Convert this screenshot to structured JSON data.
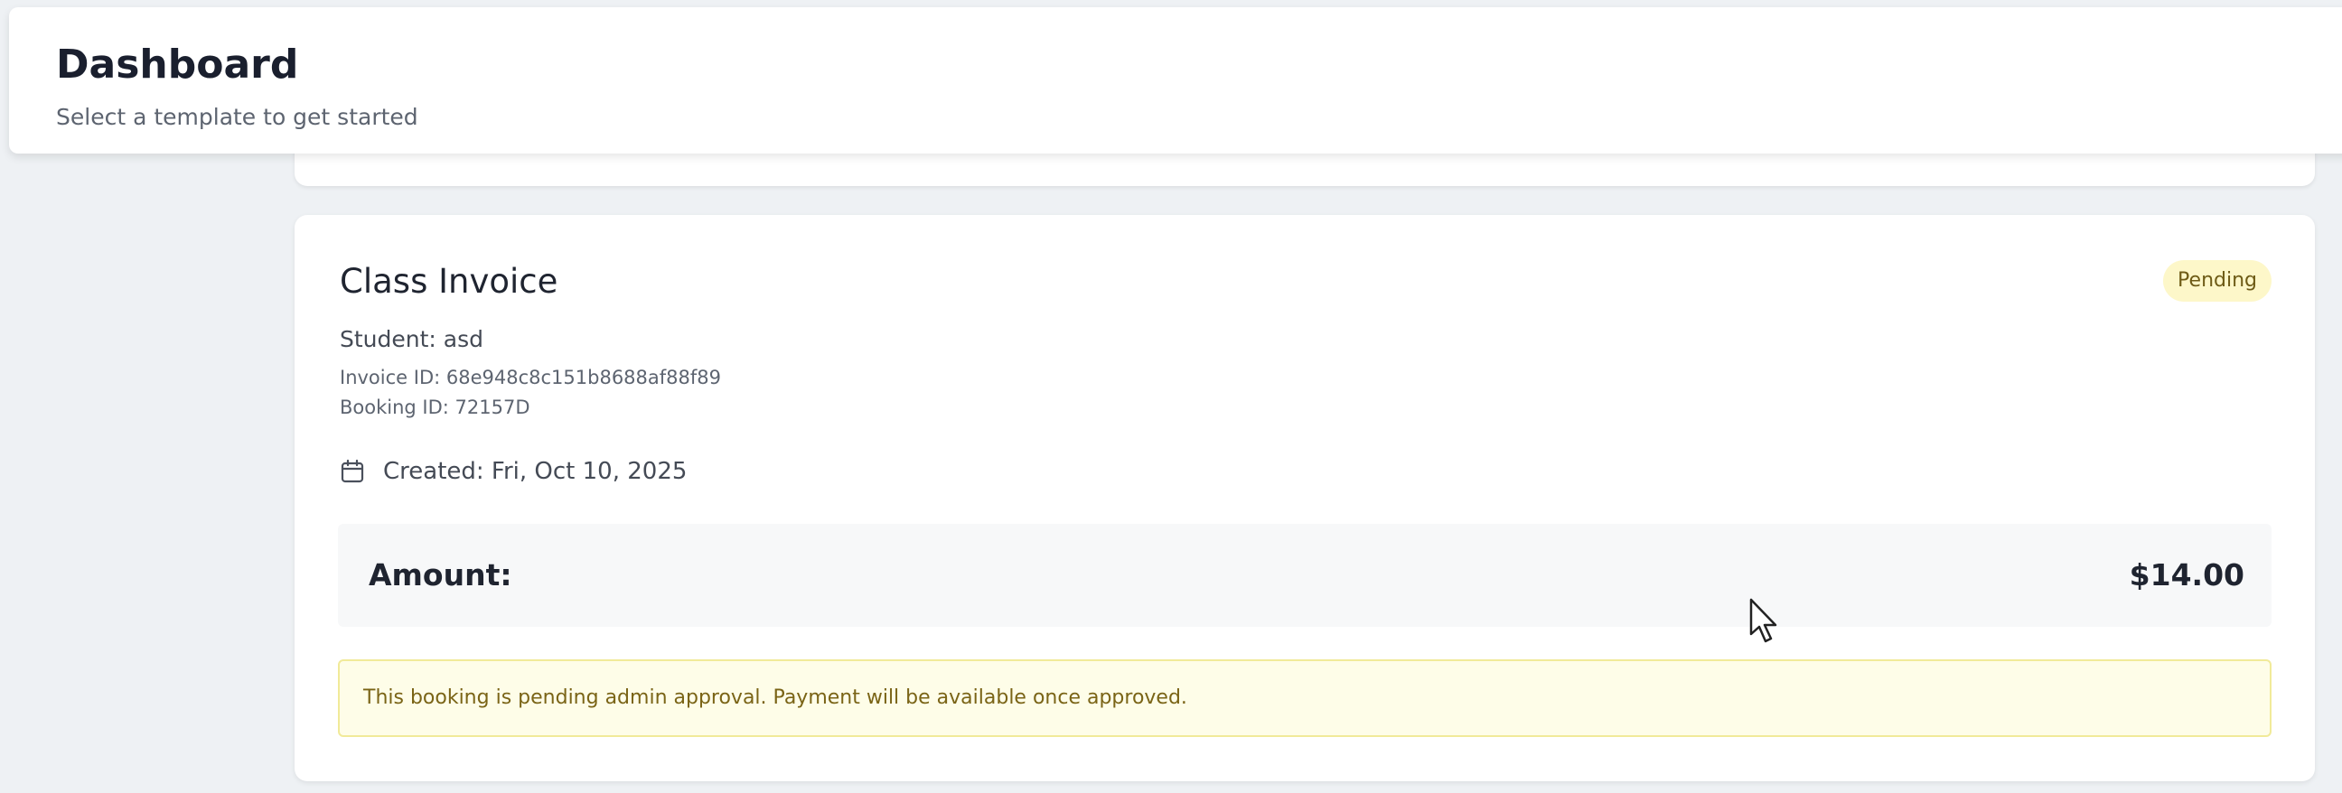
{
  "header": {
    "title": "Dashboard",
    "subtitle": "Select a template to get started"
  },
  "invoice": {
    "title": "Class Invoice",
    "status": "Pending",
    "student": "Student: asd",
    "invoice_id": "Invoice ID: 68e948c8c151b8688af88f89",
    "booking_id": "Booking ID: 72157D",
    "created": "Created: Fri, Oct 10, 2025",
    "amount_label": "Amount:",
    "amount_value": "$14.00",
    "notice": "This booking is pending admin approval. Payment will be available once approved.",
    "icons": {
      "created": "calendar-icon"
    }
  },
  "colors": {
    "page_background": "#eef1f4",
    "card_background": "#ffffff",
    "pending_badge_bg": "#fdf7c9",
    "pending_badge_text": "#6e5b16",
    "notice_bg": "#fefde8",
    "notice_border": "#f1ea99",
    "notice_text": "#7a6416"
  }
}
